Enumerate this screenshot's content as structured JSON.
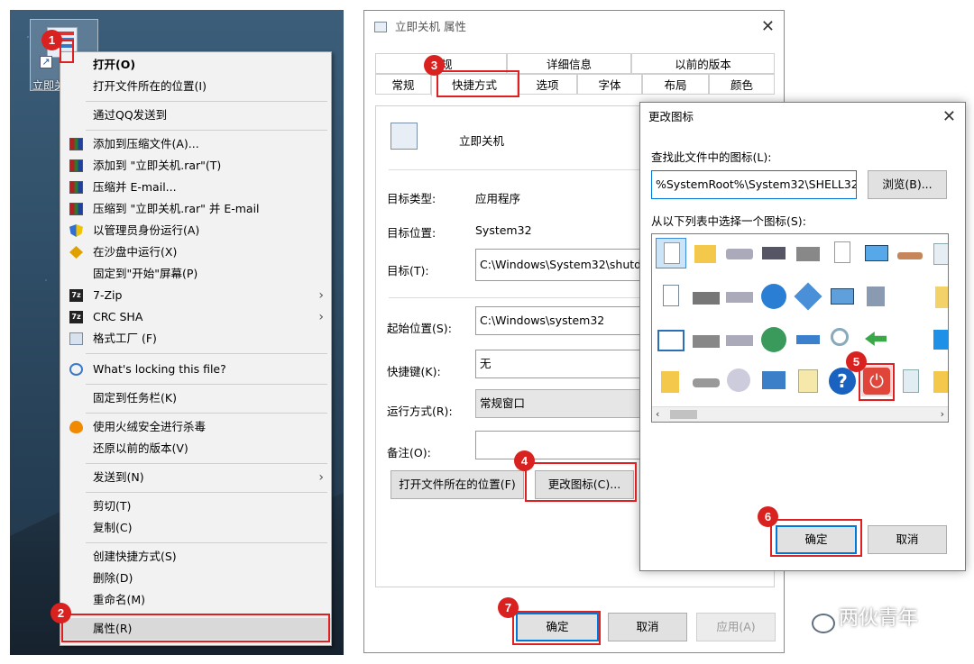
{
  "desktop": {
    "icon_label": "立即关机"
  },
  "context_menu": {
    "items": [
      {
        "label": "打开(O)"
      },
      {
        "label": "打开文件所在的位置(I)"
      },
      {
        "label": "通过QQ发送到"
      },
      {
        "label": "添加到压缩文件(A)..."
      },
      {
        "label": "添加到 \"立即关机.rar\"(T)"
      },
      {
        "label": "压缩并 E-mail..."
      },
      {
        "label": "压缩到 \"立即关机.rar\" 并 E-mail"
      },
      {
        "label": "以管理员身份运行(A)"
      },
      {
        "label": "在沙盘中运行(X)"
      },
      {
        "label": "固定到\"开始\"屏幕(P)"
      },
      {
        "label": "7-Zip"
      },
      {
        "label": "CRC SHA"
      },
      {
        "label": "格式工厂 (F)"
      },
      {
        "label": "What's locking this file?"
      },
      {
        "label": "固定到任务栏(K)"
      },
      {
        "label": "使用火绒安全进行杀毒"
      },
      {
        "label": "还原以前的版本(V)"
      },
      {
        "label": "发送到(N)"
      },
      {
        "label": "剪切(T)"
      },
      {
        "label": "复制(C)"
      },
      {
        "label": "创建快捷方式(S)"
      },
      {
        "label": "删除(D)"
      },
      {
        "label": "重命名(M)"
      },
      {
        "label": "属性(R)"
      }
    ]
  },
  "properties": {
    "title": "立即关机 属性",
    "tabs_top": [
      "常规",
      "详细信息",
      "以前的版本"
    ],
    "tabs_bottom": [
      "常规",
      "快捷方式",
      "选项",
      "字体",
      "布局",
      "颜色"
    ],
    "shortcut_name": "立即关机",
    "fields": {
      "target_type_label": "目标类型:",
      "target_type_value": "应用程序",
      "target_location_label": "目标位置:",
      "target_location_value": "System32",
      "target_label": "目标(T):",
      "target_value": "C:\\Windows\\System32\\shutdo",
      "start_in_label": "起始位置(S):",
      "start_in_value": "C:\\Windows\\system32",
      "hotkey_label": "快捷键(K):",
      "hotkey_value": "无",
      "run_label": "运行方式(R):",
      "run_value": "常规窗口",
      "comment_label": "备注(O):",
      "comment_value": ""
    },
    "buttons": {
      "open_location": "打开文件所在的位置(F)",
      "change_icon": "更改图标(C)...",
      "ok": "确定",
      "cancel": "取消",
      "apply": "应用(A)"
    }
  },
  "change_icon_dialog": {
    "title": "更改图标",
    "file_label": "查找此文件中的图标(L):",
    "file_value": "%SystemRoot%\\System32\\SHELL32.",
    "browse": "浏览(B)...",
    "list_label": "从以下列表中选择一个图标(S):",
    "ok": "确定",
    "cancel": "取消"
  },
  "steps": [
    "1",
    "2",
    "3",
    "4",
    "5",
    "6",
    "7"
  ],
  "watermark": "两伙青年",
  "colors": {
    "step_red": "#d9211f",
    "accent_blue": "#0078d7"
  }
}
